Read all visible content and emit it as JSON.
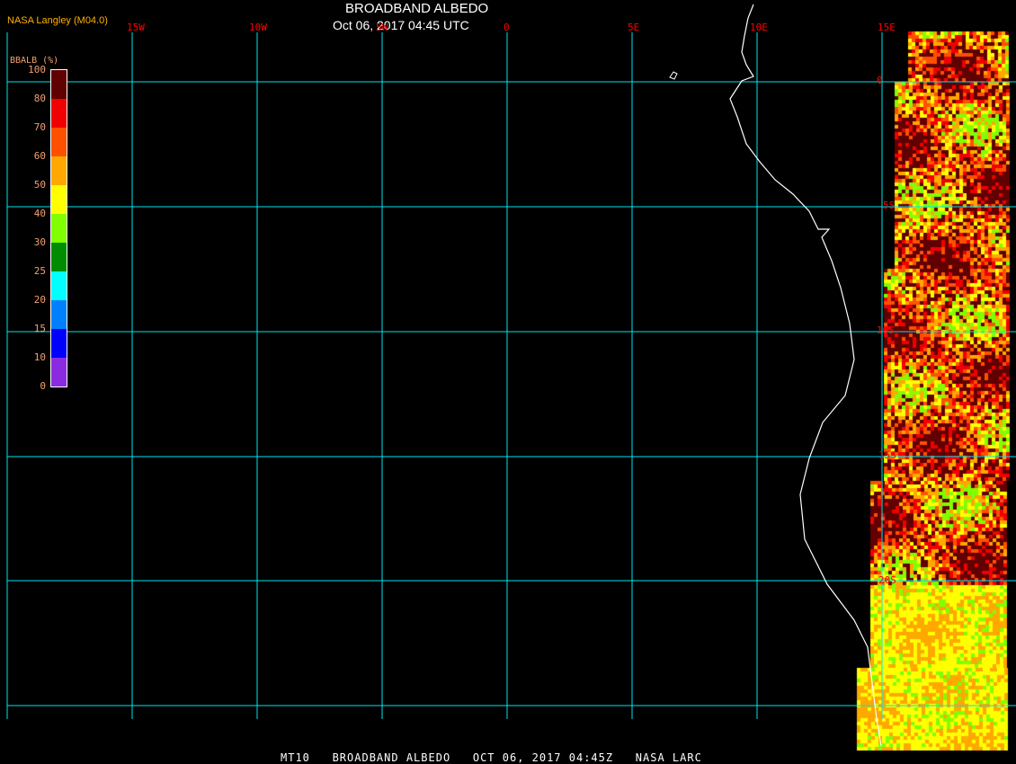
{
  "header": {
    "title": "BROADBAND ALBEDO",
    "datetime": "Oct 06, 2017 04:45 UTC",
    "credit": "NASA Langley (M04.0)"
  },
  "longitude_labels": [
    "15W",
    "10W",
    "5W",
    "0",
    "5E",
    "10E",
    "15E"
  ],
  "latitude_labels": [
    "0",
    "5S",
    "10S",
    "15S",
    "20S"
  ],
  "legend": {
    "title": "BBALB (%)",
    "labels": [
      "100",
      "80",
      "70",
      "60",
      "50",
      "40",
      "30",
      "25",
      "20",
      "15",
      "10",
      "0"
    ],
    "colors": [
      "#600000",
      "#f00000",
      "#ff5000",
      "#ffa800",
      "#ffff00",
      "#80ff00",
      "#008c00",
      "#00ffff",
      "#0080ff",
      "#0000ff",
      "#8a2be2"
    ]
  },
  "colors": {
    "grid": "#00e5ee",
    "coast": "#ffffff",
    "label": "#ff0000"
  },
  "footer": "MT10   BROADBAND ALBEDO   OCT 06, 2017 04:45Z   NASA LARC"
}
